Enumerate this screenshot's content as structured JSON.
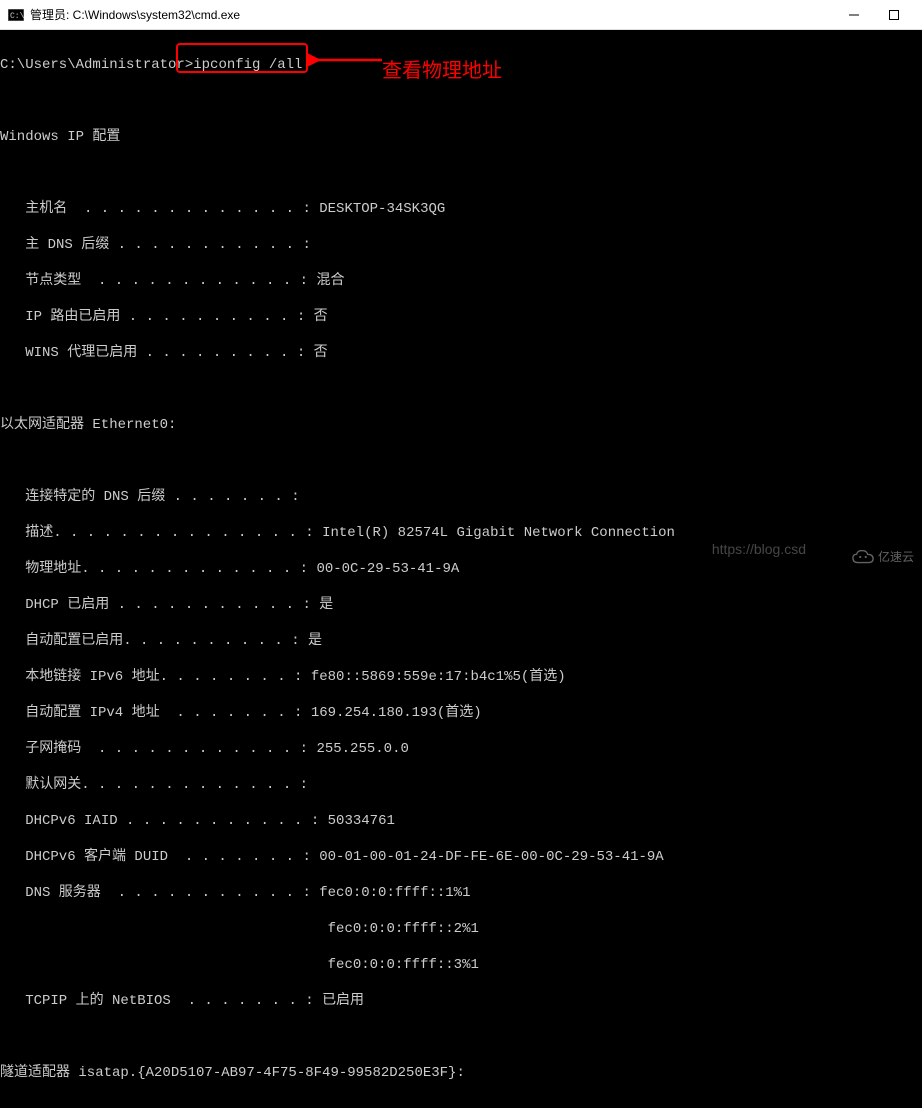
{
  "window": {
    "title": "管理员: C:\\Windows\\system32\\cmd.exe"
  },
  "prompt": {
    "path": "C:\\Users\\Administrator>",
    "command": "ipconfig /all"
  },
  "annotation": {
    "text": "查看物理地址"
  },
  "section_header": "Windows IP 配置",
  "host_config": {
    "hostname_label": "   主机名  . . . . . . . . . . . . . : ",
    "hostname_value": "DESKTOP-34SK3QG",
    "dns_suffix_label": "   主 DNS 后缀 . . . . . . . . . . . :",
    "node_type_label": "   节点类型  . . . . . . . . . . . . : ",
    "node_type_value": "混合",
    "ip_routing_label": "   IP 路由已启用 . . . . . . . . . . : ",
    "ip_routing_value": "否",
    "wins_proxy_label": "   WINS 代理已启用 . . . . . . . . . : ",
    "wins_proxy_value": "否"
  },
  "adapter_header": "以太网适配器 Ethernet0:",
  "adapter": {
    "conn_dns_label": "   连接特定的 DNS 后缀 . . . . . . . :",
    "desc_label": "   描述. . . . . . . . . . . . . . . : ",
    "desc_value": "Intel(R) 82574L Gigabit Network Connection",
    "phys_label": "   物理地址. . . . . . . . . . . . . : ",
    "phys_value": "00-0C-29-53-41-9A",
    "dhcp_en_label": "   DHCP 已启用 . . . . . . . . . . . : ",
    "dhcp_en_value": "是",
    "autoconf_label": "   自动配置已启用. . . . . . . . . . : ",
    "autoconf_value": "是",
    "ipv6ll_label": "   本地链接 IPv6 地址. . . . . . . . : ",
    "ipv6ll_value": "fe80::5869:559e:17:b4c1%5(首选)",
    "auto_v4_label": "   自动配置 IPv4 地址  . . . . . . . : ",
    "auto_v4_value": "169.254.180.193(首选)",
    "subnet_label": "   子网掩码  . . . . . . . . . . . . : ",
    "subnet_value": "255.255.0.0",
    "gateway_label": "   默认网关. . . . . . . . . . . . . :",
    "iaid_label": "   DHCPv6 IAID . . . . . . . . . . . : ",
    "iaid_value": "50334761",
    "duid_label": "   DHCPv6 客户端 DUID  . . . . . . . : ",
    "duid_value": "00-01-00-01-24-DF-FE-6E-00-0C-29-53-41-9A",
    "dns_srv_label": "   DNS 服务器  . . . . . . . . . . . : ",
    "dns_srv_value1": "fec0:0:0:ffff::1%1",
    "dns_srv_value2": "                                       fec0:0:0:ffff::2%1",
    "dns_srv_value3": "                                       fec0:0:0:ffff::3%1",
    "netbios_label": "   TCPIP 上的 NetBIOS  . . . . . . . : ",
    "netbios_value": "已启用"
  },
  "tunnel_header": "隧道适配器 isatap.{A20D5107-AB97-4F75-8F49-99582D250E3F}:",
  "watermark": {
    "url": "https://blog.csd",
    "logo_text": "亿速云"
  }
}
